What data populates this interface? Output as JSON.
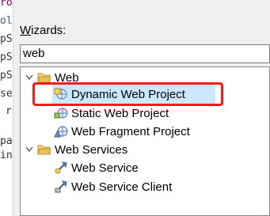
{
  "code_fragments": [
    "ro",
    "ol",
    "pS",
    "pS",
    "pS",
    "se",
    "r",
    "pa",
    "in"
  ],
  "wizards": {
    "label_underlined": "W",
    "label_rest": "izards:",
    "filter_value": "web"
  },
  "tree": {
    "web": {
      "label": "Web",
      "children": [
        "Dynamic Web Project",
        "Static Web Project",
        "Web Fragment Project"
      ]
    },
    "web_services": {
      "label": "Web Services",
      "children": [
        "Web Service",
        "Web Service Client"
      ]
    }
  },
  "colors": {
    "selection": "#cce8ff",
    "annotation": "#ff1a1a",
    "folder": "#e8c15b"
  },
  "icons": {
    "expand": "chevron-down-icon",
    "folder": "open-folder-icon",
    "dynamic": "dynamic-web-project-icon",
    "static": "static-web-project-icon",
    "fragment": "web-fragment-project-icon",
    "service": "web-service-icon",
    "client": "web-service-client-icon"
  }
}
